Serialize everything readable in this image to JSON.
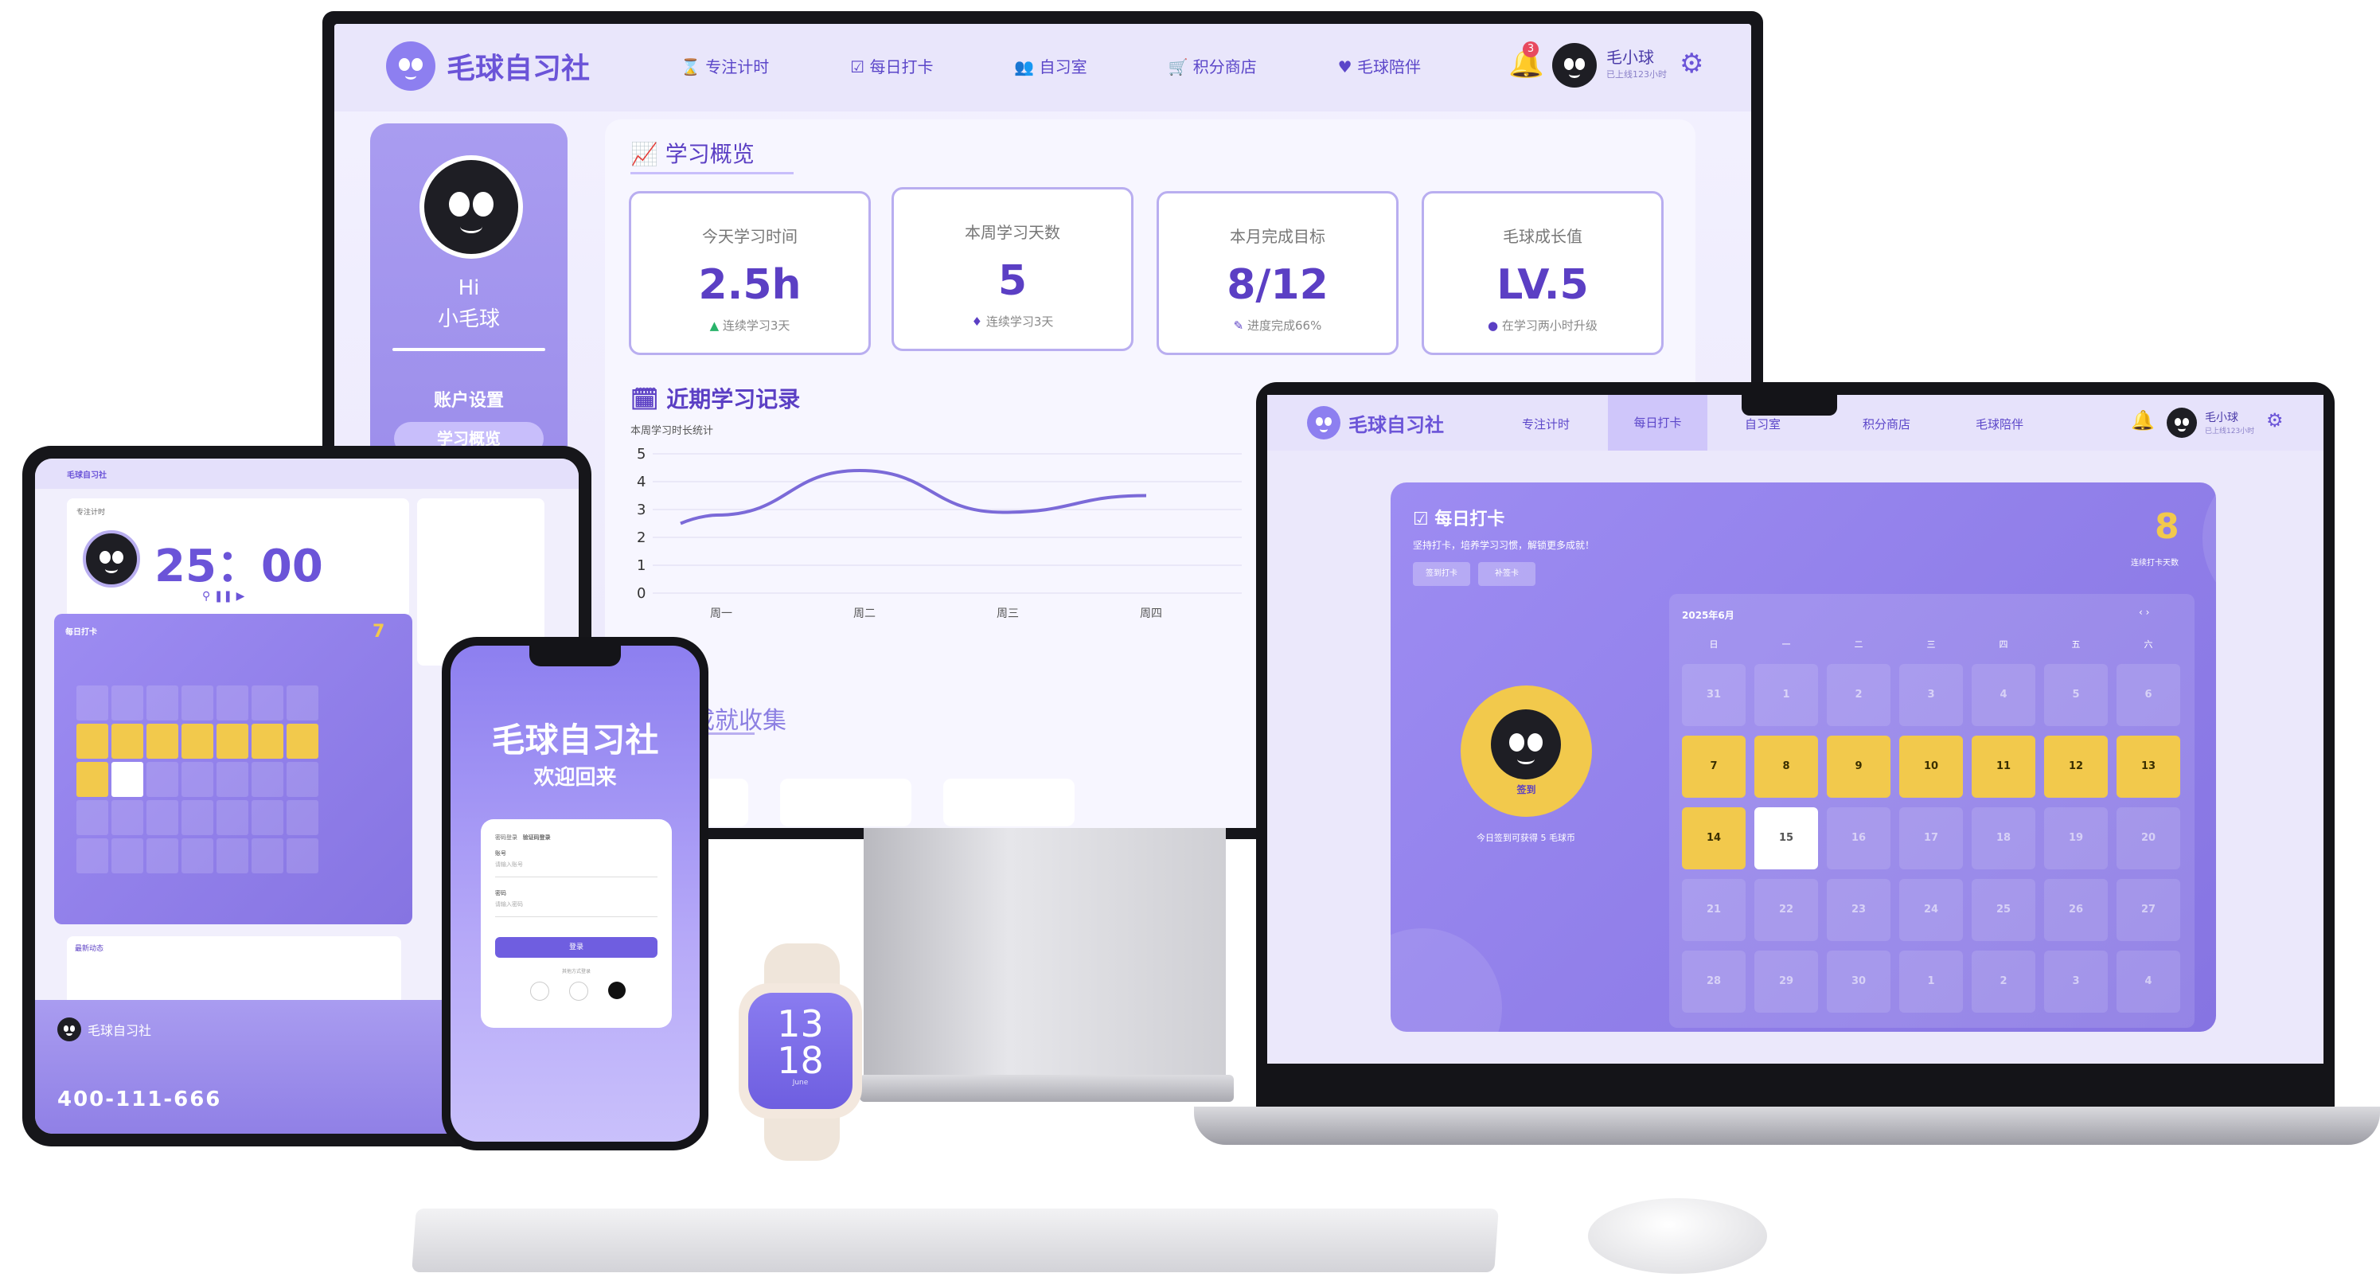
{
  "brand": {
    "name": "毛球自习社"
  },
  "desktop": {
    "nav": [
      {
        "label": "专注计时"
      },
      {
        "label": "每日打卡"
      },
      {
        "label": "自习室"
      },
      {
        "label": "积分商店"
      },
      {
        "label": "毛球陪伴"
      }
    ],
    "notification_count": "3",
    "user": {
      "name": "毛小球",
      "sub": "已上线123小时"
    },
    "sidebar": {
      "greeting": "Hi",
      "name": "小毛球",
      "account": "账户设置",
      "overview_btn": "学习概览"
    },
    "overview_title": "学习概览",
    "stats": [
      {
        "label": "今天学习时间",
        "value": "2.5h",
        "sub": "连续学习3天"
      },
      {
        "label": "本周学习天数",
        "value": "5",
        "sub": "连续学习3天"
      },
      {
        "label": "本月完成目标",
        "value": "8/12",
        "sub": "进度完成66%"
      },
      {
        "label": "毛球成长值",
        "value": "LV.5",
        "sub": "在学习两小时升级"
      }
    ],
    "records_title": "近期学习记录",
    "chart_caption": "本周学习时长统计",
    "collection_title": "成就收集"
  },
  "chart_data": {
    "type": "line",
    "categories": [
      "周一",
      "周二",
      "周三",
      "周四"
    ],
    "values": [
      2.8,
      4.4,
      2.9,
      3.5
    ],
    "title": "",
    "xlabel": "",
    "ylabel": "",
    "ylim": [
      0,
      5
    ],
    "yticks": [
      "0",
      "1",
      "2",
      "3",
      "4",
      "5"
    ],
    "grid": true
  },
  "laptop": {
    "nav": [
      {
        "label": "专注计时"
      },
      {
        "label": "每日打卡"
      },
      {
        "label": "自习室"
      },
      {
        "label": "积分商店"
      },
      {
        "label": "毛球陪伴"
      }
    ],
    "user": {
      "name": "毛小球",
      "sub": "已上线123小时"
    },
    "checkin": {
      "title": "每日打卡",
      "subtitle": "坚持打卡，培养学习习惯，解锁更多成就！",
      "btn1": "签到打卡",
      "btn2": "补签卡",
      "streak": "8",
      "streak_label": "连续打卡天数",
      "month": "2025年6月",
      "weekdays": [
        "日",
        "一",
        "二",
        "三",
        "四",
        "五",
        "六"
      ],
      "days": [
        [
          "31",
          "1",
          "2",
          "3",
          "4",
          "5",
          "6"
        ],
        [
          "7",
          "8",
          "9",
          "10",
          "11",
          "12",
          "13"
        ],
        [
          "14",
          "15",
          "16",
          "17",
          "18",
          "19",
          "20"
        ],
        [
          "21",
          "22",
          "23",
          "24",
          "25",
          "26",
          "27"
        ],
        [
          "28",
          "29",
          "30",
          "1",
          "2",
          "3",
          "4"
        ]
      ],
      "mascot_tag": "签到",
      "mascot_note": "今日签到可获得 5 毛球币"
    }
  },
  "tablet": {
    "timer_label": "专注计时",
    "timer": "25：00",
    "checkin_title": "每日打卡",
    "streak": "7",
    "record_title": "最新动态",
    "footer_brand": "毛球自习社",
    "phone": "400-111-666"
  },
  "phone": {
    "title": "毛球自习社",
    "subtitle": "欢迎回来",
    "tab1": "密码登录",
    "tab2": "验证码登录",
    "field1": "账号",
    "field1_ph": "请输入账号",
    "field2": "密码",
    "field2_ph": "请输入密码",
    "login": "登录",
    "other": "其他方式登录"
  },
  "watch": {
    "hour": "13",
    "minute": "18",
    "sub": "June"
  }
}
